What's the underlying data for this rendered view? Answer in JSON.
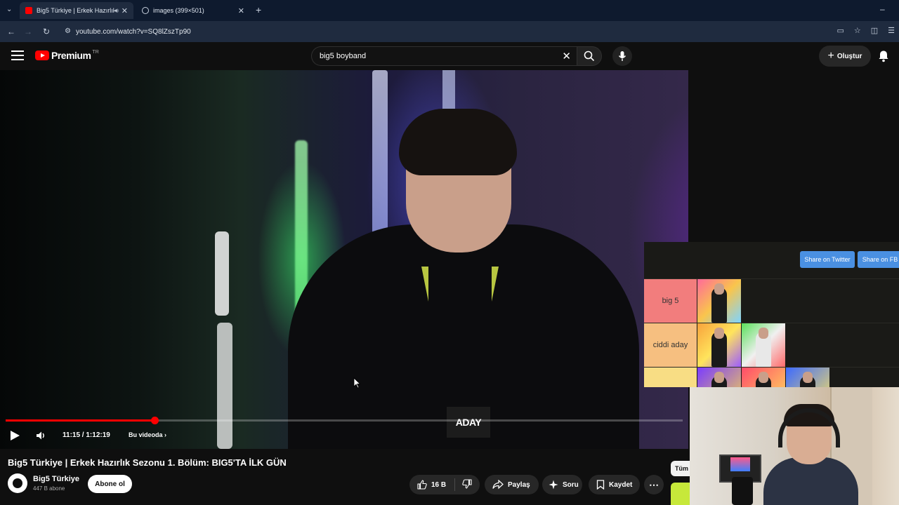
{
  "browser": {
    "tabs": [
      {
        "title": "Big5 Türkiye | Erkek Hazırlık",
        "active": true
      },
      {
        "title": "images (399×501)",
        "active": false
      }
    ],
    "new_tab_symbol": "+",
    "window_minimize": "–",
    "url": "youtube.com/watch?v=SQ8lZszTp90"
  },
  "youtube": {
    "logo_text": "Premium",
    "region": "TR",
    "search_value": "big5 boyband",
    "create_label": "Oluştur"
  },
  "player": {
    "time_display": "11:15 / 1:12:19",
    "chapter_label": "Bu videoda",
    "progress_fraction": 0.2197,
    "badge_text": "ADAY"
  },
  "tier_list": {
    "share_twitter": "Share on Twitter",
    "share_fb": "Share on FB",
    "rows": [
      {
        "label": "big 5",
        "color": "#f27d7d",
        "images": 1
      },
      {
        "label": "ciddi aday",
        "color": "#f6bf80",
        "images": 2
      },
      {
        "label": "",
        "color": "#f8dd84",
        "images": 3
      }
    ]
  },
  "video_info": {
    "title": "Big5 Türkiye | Erkek Hazırlık Sezonu 1. Bölüm: BIG5'TA İLK GÜN",
    "channel_name": "Big5 Türkiye",
    "subscribers": "447 B abone",
    "subscribe_label": "Abone ol",
    "likes": "16 B",
    "share_label": "Paylaş",
    "ask_label": "Soru",
    "save_label": "Kaydet",
    "more_symbol": "⋯",
    "side_chip": "Tüm"
  },
  "colors": {
    "accent_red": "#ff0000",
    "background": "#0f0f0f",
    "share_blue": "#4a90e2"
  }
}
